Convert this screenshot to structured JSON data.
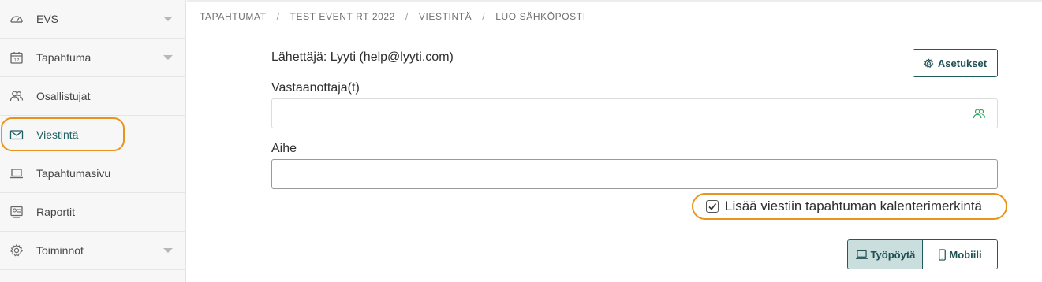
{
  "sidebar": {
    "items": [
      {
        "label": "EVS",
        "icon": "dashboard-gauge-icon",
        "has_dropdown": true
      },
      {
        "label": "Tapahtuma",
        "icon": "calendar-icon",
        "has_dropdown": true
      },
      {
        "label": "Osallistujat",
        "icon": "people-icon",
        "has_dropdown": false
      },
      {
        "label": "Viestintä",
        "icon": "envelope-icon",
        "has_dropdown": false,
        "active": true
      },
      {
        "label": "Tapahtumasivu",
        "icon": "laptop-icon",
        "has_dropdown": false
      },
      {
        "label": "Raportit",
        "icon": "report-icon",
        "has_dropdown": false
      },
      {
        "label": "Toiminnot",
        "icon": "gear-icon",
        "has_dropdown": true
      }
    ]
  },
  "breadcrumb": {
    "items": [
      "TAPAHTUMAT",
      "TEST EVENT RT 2022",
      "VIESTINTÄ",
      "LUO SÄHKÖPOSTI"
    ],
    "separator": "/"
  },
  "form": {
    "sender": "Lähettäjä: Lyyti (help@lyyti.com)",
    "settings_label": "Asetukset",
    "recipients_label": "Vastaanottaja(t)",
    "recipients_value": "",
    "subject_label": "Aihe",
    "subject_value": "",
    "calendar_checkbox_label": "Lisää viestiin tapahtuman kalenterimerkintä",
    "calendar_checked": true
  },
  "view_toggle": {
    "desktop_label": "Työpöytä",
    "mobile_label": "Mobiili",
    "selected": "desktop"
  },
  "colors": {
    "accent": "#1e5c60",
    "highlight": "#e8941a",
    "toggle_selected": "#c9dedd",
    "people_icon": "#2aa65a"
  }
}
